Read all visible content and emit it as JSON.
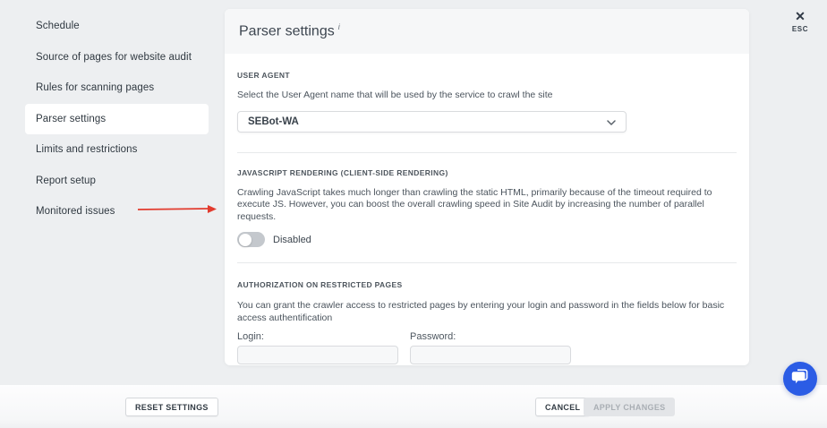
{
  "sidebar": {
    "items": [
      {
        "label": "Schedule",
        "selected": false
      },
      {
        "label": "Source of pages for website audit",
        "selected": false
      },
      {
        "label": "Rules for scanning pages",
        "selected": false
      },
      {
        "label": "Parser settings",
        "selected": true
      },
      {
        "label": "Limits and restrictions",
        "selected": false
      },
      {
        "label": "Report setup",
        "selected": false
      },
      {
        "label": "Monitored issues",
        "selected": false
      }
    ]
  },
  "header": {
    "title": "Parser settings",
    "info_mark": "i"
  },
  "close": {
    "icon": "✕",
    "label": "ESC"
  },
  "sections": {
    "user_agent": {
      "label": "USER AGENT",
      "description": "Select the User Agent name that will be used by the service to crawl the site",
      "dropdown_value": "SEBot-WA"
    },
    "js_rendering": {
      "label": "JAVASCRIPT RENDERING (CLIENT-SIDE RENDERING)",
      "description": "Crawling JavaScript takes much longer than crawling the static HTML, primarily because of the timeout required to execute JS. However, you can boost the overall crawling speed in Site Audit by increasing the number of parallel requests.",
      "toggle_state": "Disabled",
      "toggle_on": false
    },
    "authorization": {
      "label": "AUTHORIZATION ON RESTRICTED PAGES",
      "description": "You can grant the crawler access to restricted pages by entering your login and password in the fields below for basic access authentification",
      "login_label": "Login:",
      "login_value": "",
      "password_label": "Password:",
      "password_value": ""
    }
  },
  "footer": {
    "reset_label": "RESET SETTINGS",
    "cancel_label": "CANCEL",
    "apply_label": "APPLY CHANGES"
  },
  "colors": {
    "accent_blue": "#2b5ce5",
    "arrow_red": "#e23b2e",
    "backdrop": "#edeff1",
    "panel_header_bg": "#f6f7f8",
    "disabled_button_bg": "#e3e5e8"
  }
}
